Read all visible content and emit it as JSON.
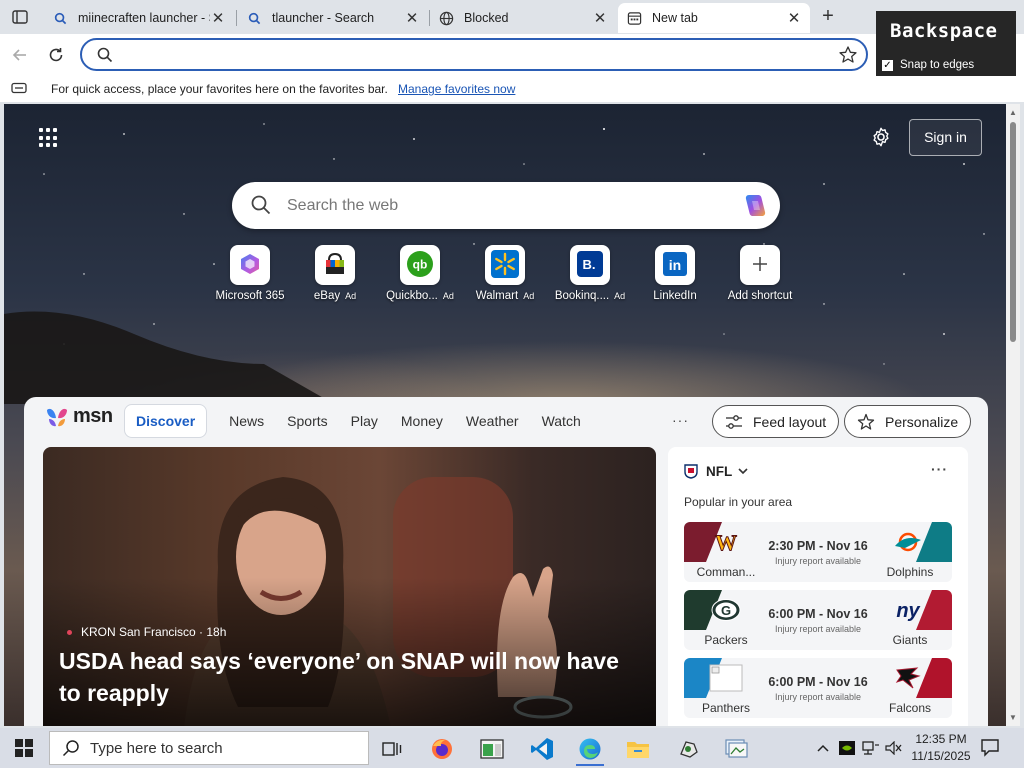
{
  "browser": {
    "tabs": [
      {
        "title": "miinecraften launcher - S",
        "icon": "search-icon",
        "active": false
      },
      {
        "title": "tlauncher - Search",
        "icon": "search-icon",
        "active": false
      },
      {
        "title": "Blocked",
        "icon": "globe-icon",
        "active": false
      },
      {
        "title": "New tab",
        "icon": "new-tab-icon",
        "active": true
      }
    ],
    "address_value": "",
    "favorites_bar": {
      "text": "For quick access, place your favorites here on the favorites bar.",
      "link": "Manage favorites now"
    }
  },
  "overlay": {
    "key_name": "Backspace",
    "snap_label": "Snap to edges",
    "snap_checked": true
  },
  "newtab": {
    "signin_label": "Sign in",
    "search_placeholder": "Search the web",
    "shortcuts": [
      {
        "label": "Microsoft 365",
        "ad": "",
        "icon": "microsoft365-icon"
      },
      {
        "label": "eBay",
        "ad": "Ad",
        "icon": "ebay-icon"
      },
      {
        "label": "Quickbo...",
        "ad": "Ad",
        "icon": "quickbooks-icon"
      },
      {
        "label": "Walmart",
        "ad": "Ad",
        "icon": "walmart-icon"
      },
      {
        "label": "Bookinq....",
        "ad": "Ad",
        "icon": "booking-icon"
      },
      {
        "label": "LinkedIn",
        "ad": "",
        "icon": "linkedin-icon"
      },
      {
        "label": "Add shortcut",
        "ad": "",
        "icon": "plus-icon"
      }
    ]
  },
  "feed": {
    "logo_text": "msn",
    "nav": [
      "Discover",
      "News",
      "Sports",
      "Play",
      "Money",
      "Weather",
      "Watch"
    ],
    "more": "···",
    "feed_layout_label": "Feed layout",
    "personalize_label": "Personalize",
    "hero": {
      "source": "KRON San Francisco · 18h",
      "title": "USDA head says ‘everyone’ on SNAP will now have to reapply"
    },
    "nfl": {
      "league": "NFL",
      "subtitle": "Popular in your area",
      "more": "···",
      "games": [
        {
          "home": "Comman...",
          "away": "Dolphins",
          "time": "2:30 PM - Nov 16",
          "note": "Injury report available",
          "left_color": "#7b1c2e",
          "right_color": "#0e7c86"
        },
        {
          "home": "Packers",
          "away": "Giants",
          "time": "6:00 PM - Nov 16",
          "note": "Injury report available",
          "left_color": "#1f3b2e",
          "right_color": "#b21b32"
        },
        {
          "home": "Panthers",
          "away": "Falcons",
          "time": "6:00 PM - Nov 16",
          "note": "Injury report available",
          "left_color": "#1b86c6",
          "right_color": "#b0132b"
        }
      ]
    }
  },
  "taskbar": {
    "search_placeholder": "Type here to search",
    "time": "12:35 PM",
    "date": "11/15/2025"
  }
}
